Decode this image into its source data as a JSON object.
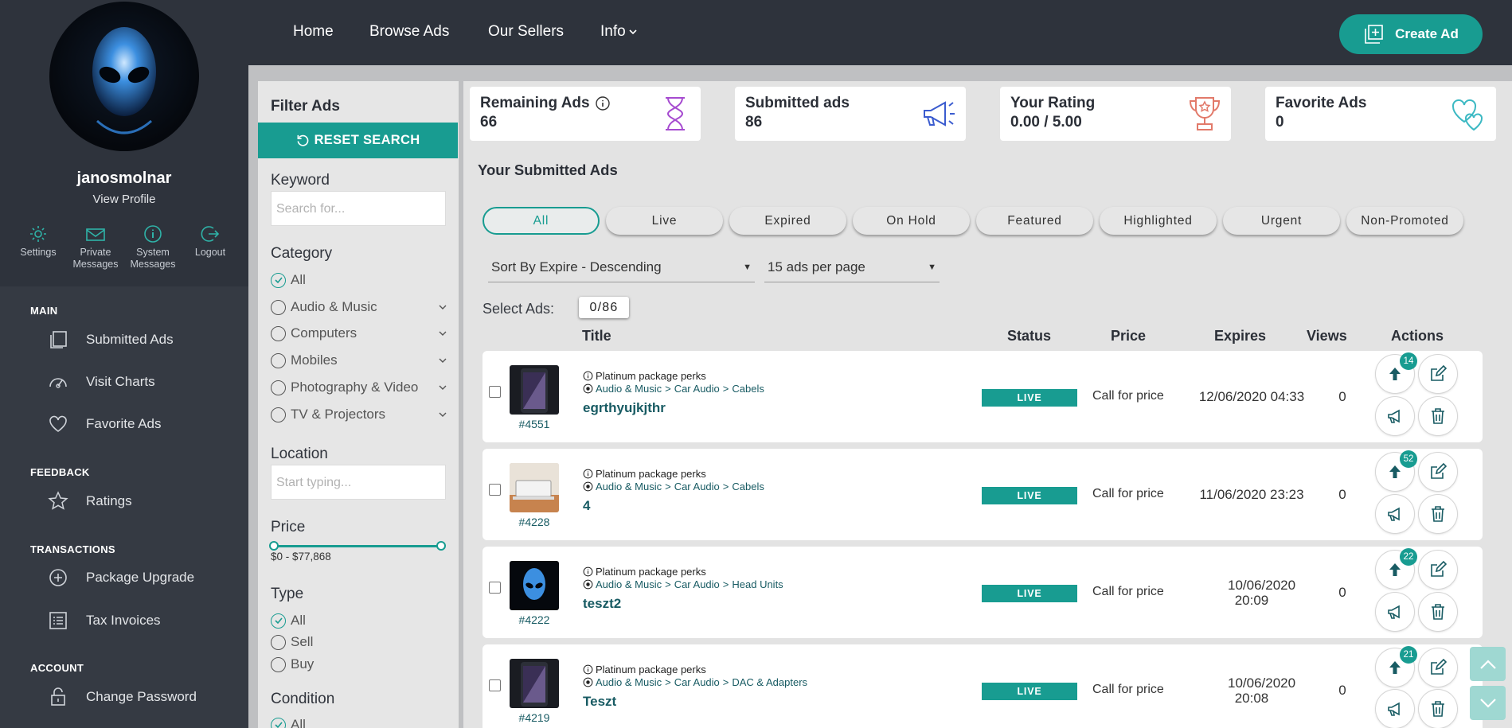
{
  "user": {
    "name": "janosmolnar",
    "view_profile": "View Profile"
  },
  "quick_links": [
    "Settings",
    "Private Messages",
    "System Messages",
    "Logout"
  ],
  "sidebar": {
    "main_title": "MAIN",
    "main_items": [
      "Submitted Ads",
      "Visit Charts",
      "Favorite Ads"
    ],
    "feedback_title": "FEEDBACK",
    "feedback_items": [
      "Ratings"
    ],
    "transactions_title": "TRANSACTIONS",
    "transactions_items": [
      "Package Upgrade",
      "Tax Invoices"
    ],
    "account_title": "ACCOUNT",
    "account_items": [
      "Change Password"
    ]
  },
  "nav": {
    "home": "Home",
    "browse": "Browse Ads",
    "sellers": "Our Sellers",
    "info": "Info",
    "create_ad": "Create Ad"
  },
  "filter": {
    "title": "Filter Ads",
    "reset": "RESET SEARCH",
    "keyword_label": "Keyword",
    "keyword_placeholder": "Search for...",
    "category_label": "Category",
    "categories": [
      "All",
      "Audio & Music",
      "Computers",
      "Mobiles",
      "Photography & Video",
      "TV & Projectors"
    ],
    "location_label": "Location",
    "location_placeholder": "Start typing...",
    "price_label": "Price",
    "price_range": "$0 - $77,868",
    "type_label": "Type",
    "types": [
      "All",
      "Sell",
      "Buy"
    ],
    "condition_label": "Condition",
    "conditions": [
      "All"
    ]
  },
  "stats": {
    "remaining_label": "Remaining Ads",
    "remaining_value": "66",
    "submitted_label": "Submitted ads",
    "submitted_value": "86",
    "rating_label": "Your Rating",
    "rating_value": "0.00 / 5.00",
    "favorites_label": "Favorite Ads",
    "favorites_value": "0"
  },
  "ads_section": {
    "title": "Your Submitted Ads",
    "tabs": [
      "All",
      "Live",
      "Expired",
      "On Hold",
      "Featured",
      "Highlighted",
      "Urgent",
      "Non-Promoted"
    ],
    "sort": "Sort By Expire - Descending",
    "per_page": "15 ads per page",
    "select_label": "Select Ads:",
    "select_count": "0/86",
    "columns": {
      "title": "Title",
      "status": "Status",
      "price": "Price",
      "expires": "Expires",
      "views": "Views",
      "actions": "Actions"
    }
  },
  "ads": [
    {
      "id": "#4551",
      "perks": "Platinum package perks",
      "crumbs": [
        "Audio & Music",
        "Car Audio",
        "Cabels"
      ],
      "title": "egrthyujkjthr",
      "status": "LIVE",
      "price": "Call for price",
      "expires": "12/06/2020 04:33",
      "views": "0",
      "bumps": "14"
    },
    {
      "id": "#4228",
      "perks": "Platinum package perks",
      "crumbs": [
        "Audio & Music",
        "Car Audio",
        "Cabels"
      ],
      "title": "4",
      "status": "LIVE",
      "price": "Call for price",
      "expires": "11/06/2020 23:23",
      "views": "0",
      "bumps": "52"
    },
    {
      "id": "#4222",
      "perks": "Platinum package perks",
      "crumbs": [
        "Audio & Music",
        "Car Audio",
        "Head Units"
      ],
      "title": "teszt2",
      "status": "LIVE",
      "price": "Call for price",
      "expires": "10/06/2020 20:09",
      "views": "0",
      "bumps": "22"
    },
    {
      "id": "#4219",
      "perks": "Platinum package perks",
      "crumbs": [
        "Audio & Music",
        "Car Audio",
        "DAC & Adapters"
      ],
      "title": "Teszt",
      "status": "LIVE",
      "price": "Call for price",
      "expires": "10/06/2020 20:08",
      "views": "0",
      "bumps": "21"
    }
  ],
  "colors": {
    "accent": "#189c91",
    "sidebar": "#353a43",
    "topbar": "#2e333c",
    "link": "#185b63"
  }
}
